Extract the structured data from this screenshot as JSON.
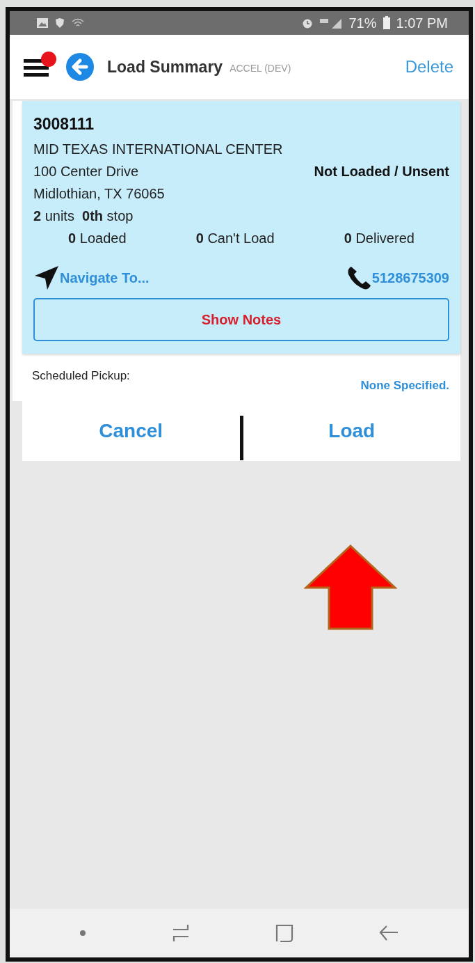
{
  "status_bar": {
    "battery": "71%",
    "time": "1:07 PM"
  },
  "header": {
    "has_notification": true,
    "title": "Load Summary",
    "subtitle": "ACCEL (DEV)",
    "action": "Delete"
  },
  "stop": {
    "number": "3008111",
    "name": "MID TEXAS INTERNATIONAL CENTER",
    "address": "100 Center Drive",
    "status": "Not Loaded / Unsent",
    "city": "Midlothian, TX 76065",
    "summary": "**2** units  **0th** stop",
    "counts": [
      "**0** Loaded",
      "**0** Can't Load",
      "**0** Delivered"
    ],
    "navigate": "Navigate To...",
    "phone": "5128675309",
    "notes_button": "Show Notes"
  },
  "schedule": {
    "label": "Scheduled Pickup:",
    "value": "None Specified."
  },
  "buttons": [
    {
      "label": "Cancel"
    },
    {
      "label": "Load"
    }
  ]
}
